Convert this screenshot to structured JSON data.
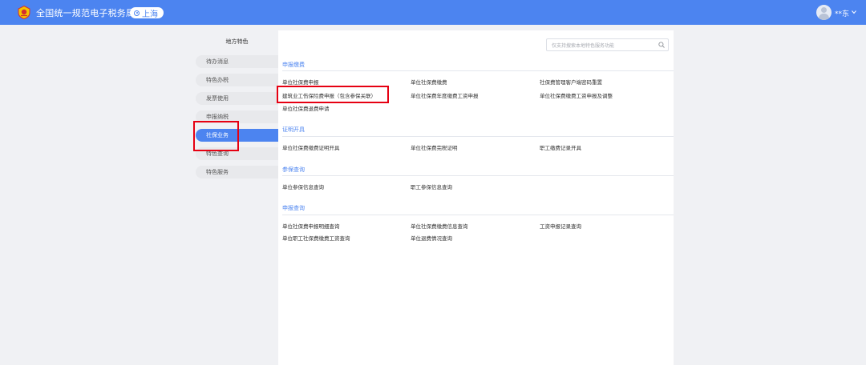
{
  "header": {
    "title": "全国统一规范电子税务局",
    "region": "上海",
    "username": "**东",
    "colors": {
      "primary": "#4c84f0",
      "highlight": "#e60012"
    }
  },
  "sidebar": {
    "title": "地方特色",
    "items": [
      {
        "label": "待办消息"
      },
      {
        "label": "特色办税"
      },
      {
        "label": "发票使用"
      },
      {
        "label": "申报纳税"
      },
      {
        "label": "社保业务",
        "active": true
      },
      {
        "label": "特色查询"
      },
      {
        "label": "特色服务"
      }
    ]
  },
  "search": {
    "placeholder": "仅支持搜索本地特色服务功能"
  },
  "sections": [
    {
      "title": "申报缴费",
      "items": [
        "单位社保费申报",
        "单位社保费缴费",
        "社保费管理客户端密码重置",
        "建筑业工伤保险费申报（包含参保关联）",
        "单位社保费年度缴费工资申报",
        "单位社保费缴费工资申报及调整",
        "单位社保费退费申请"
      ]
    },
    {
      "title": "证明开具",
      "items": [
        "单位社保费缴费证明开具",
        "单位社保费完税证明",
        "职工缴费记录开具"
      ]
    },
    {
      "title": "参保查询",
      "items": [
        "单位参保信息查询",
        "职工参保信息查询"
      ]
    },
    {
      "title": "申报查询",
      "items": [
        "单位社保费申报明细查询",
        "单位社保费缴费信息查询",
        "工资申报记录查询",
        "单位职工社保费缴费工资查询",
        "单位退费情况查询"
      ]
    }
  ]
}
